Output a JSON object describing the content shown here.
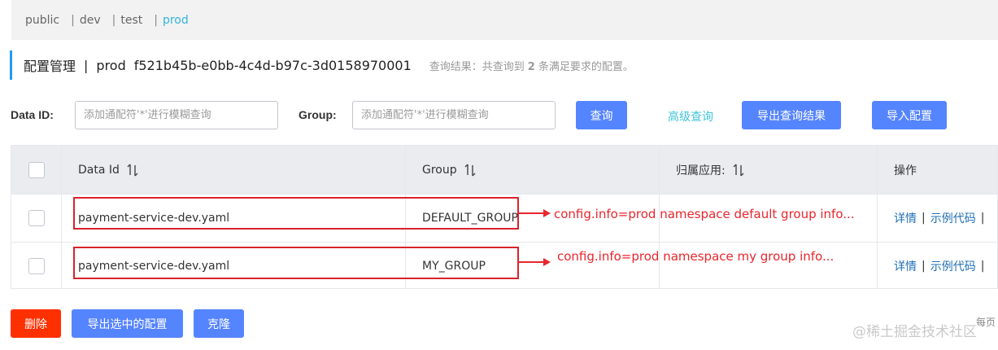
{
  "namespaces": [
    {
      "label": "public",
      "active": false
    },
    {
      "label": "dev",
      "active": false
    },
    {
      "label": "test",
      "active": false
    },
    {
      "label": "prod",
      "active": true
    }
  ],
  "namespace_separator": "|",
  "title": {
    "main": "配置管理",
    "separator": "|",
    "namespace": "prod",
    "namespace_id": "f521b45b-e0bb-4c4d-b97c-3d0158970001",
    "result_prefix": "查询结果：共查询到",
    "result_count": "2",
    "result_suffix": "条满足要求的配置。"
  },
  "search": {
    "data_id_label": "Data ID:",
    "data_id_placeholder": "添加通配符'*'进行模糊查询",
    "group_label": "Group:",
    "group_placeholder": "添加通配符'*'进行模糊查询",
    "query_button": "查询",
    "advanced_link": "高级查询",
    "export_results_button": "导出查询结果",
    "import_button": "导入配置"
  },
  "table": {
    "headers": {
      "data_id": "Data Id",
      "group": "Group",
      "app": "归属应用:",
      "actions": "操作"
    },
    "rows": [
      {
        "data_id": "payment-service-dev.yaml",
        "group": "DEFAULT_GROUP",
        "annotation": "config.info=prod namespace default group info...",
        "actions": [
          "详情",
          "示例代码"
        ]
      },
      {
        "data_id": "payment-service-dev.yaml",
        "group": "MY_GROUP",
        "annotation": "config.info=prod namespace my group info...",
        "actions": [
          "详情",
          "示例代码"
        ]
      }
    ]
  },
  "footer": {
    "delete_button": "删除",
    "export_selected_button": "导出选中的配置",
    "clone_button": "克隆",
    "per_page": "每页",
    "watermark": "@稀土掘金技术社区"
  },
  "colors": {
    "primary": "#5584ff",
    "danger": "#ff3000",
    "active_tab": "#33b5d8",
    "annotation": "#e8262d",
    "link": "#1f6fb5"
  }
}
